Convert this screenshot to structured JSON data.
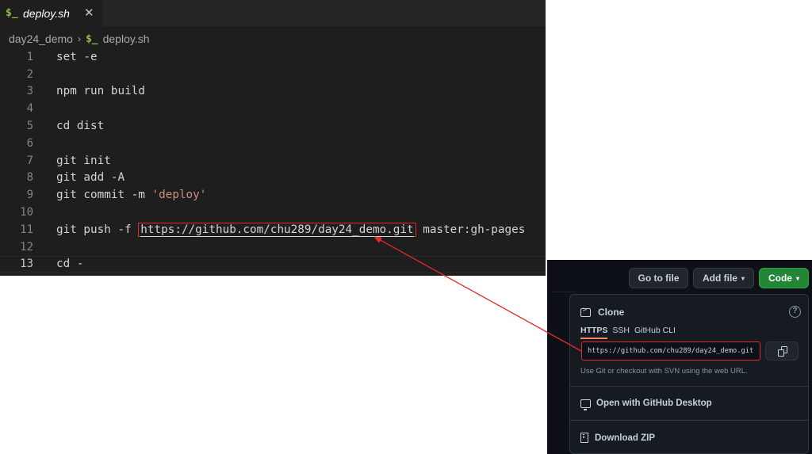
{
  "editor": {
    "tab": {
      "icon": "$_",
      "filename": "deploy.sh",
      "close": "✕"
    },
    "breadcrumb": {
      "folder": "day24_demo",
      "separator": "›",
      "icon": "$_",
      "file": "deploy.sh"
    },
    "lines": [
      {
        "num": "1",
        "pre": "set -e"
      },
      {
        "num": "2",
        "pre": ""
      },
      {
        "num": "3",
        "pre": "npm run build"
      },
      {
        "num": "4",
        "pre": ""
      },
      {
        "num": "5",
        "pre": "cd dist"
      },
      {
        "num": "6",
        "pre": ""
      },
      {
        "num": "7",
        "pre": "git init"
      },
      {
        "num": "8",
        "pre": "git add -A"
      },
      {
        "num": "9",
        "pre": "git commit -m ",
        "str": "'deploy'"
      },
      {
        "num": "10",
        "pre": ""
      },
      {
        "num": "11",
        "pre": "git push -f ",
        "url": "https://github.com/chu289/day24_demo.git",
        "post": " master:gh-pages"
      },
      {
        "num": "12",
        "pre": ""
      },
      {
        "num": "13",
        "pre": "cd -"
      }
    ]
  },
  "github": {
    "go_to_file": "Go to file",
    "add_file": "Add file",
    "code": "Code",
    "caret": "▾",
    "clone": {
      "title": "Clone",
      "help": "?",
      "tabs": [
        "HTTPS",
        "SSH",
        "GitHub CLI"
      ],
      "url": "https://github.com/chu289/day24_demo.git",
      "help_text": "Use Git or checkout with SVN using the web URL."
    },
    "open_desktop": "Open with GitHub Desktop",
    "download_zip": "Download ZIP"
  },
  "colors": {
    "editor_bg": "#1e1e1e",
    "github_bg": "#0d1117",
    "highlight_red": "#e02b2b",
    "code_green": "#238636"
  }
}
